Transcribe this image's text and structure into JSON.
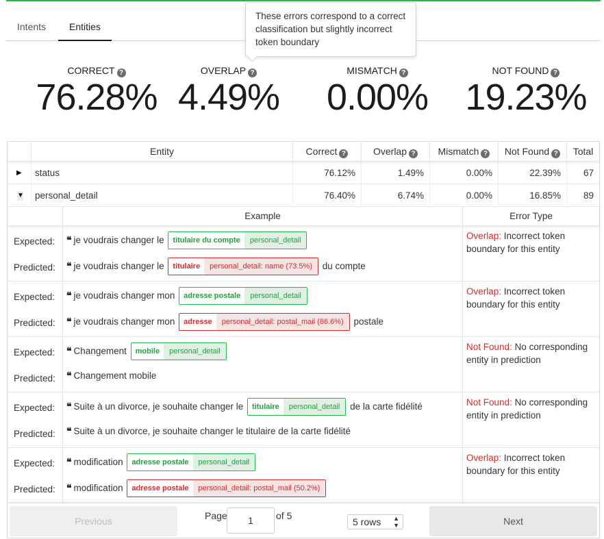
{
  "tabs": [
    {
      "label": "Intents"
    },
    {
      "label": "Entities"
    }
  ],
  "tooltip": "These errors correspond to a correct classification but slightly incorrect token boundary",
  "stats": [
    {
      "label": "CORRECT",
      "value": "76.28%"
    },
    {
      "label": "OVERLAP",
      "value": "4.49%"
    },
    {
      "label": "MISMATCH",
      "value": "0.00%"
    },
    {
      "label": "NOT FOUND",
      "value": "19.23%"
    }
  ],
  "table": {
    "headers": {
      "entity": "Entity",
      "correct": "Correct",
      "overlap": "Overlap",
      "mismatch": "Mismatch",
      "not_found": "Not Found",
      "total": "Total"
    },
    "rows": [
      {
        "entity": "status",
        "correct": "76.12%",
        "overlap": "1.49%",
        "mismatch": "0.00%",
        "not_found": "22.39%",
        "total": "67",
        "expanded": false
      },
      {
        "entity": "personal_detail",
        "correct": "76.40%",
        "overlap": "6.74%",
        "mismatch": "0.00%",
        "not_found": "16.85%",
        "total": "89",
        "expanded": true
      }
    ]
  },
  "subtable": {
    "headers": {
      "example": "Example",
      "error_type": "Error Type"
    },
    "expected_label": "Expected:",
    "predicted_label": "Predicted:",
    "examples": [
      {
        "expected": {
          "before": "je voudrais changer le",
          "tag_text": "titulaire du compte",
          "tag_entity": "personal_detail",
          "after": ""
        },
        "predicted": {
          "before": "je voudrais changer le",
          "tag_text": "titulaire",
          "tag_entity": "personal_detail: name (73.5%)",
          "after": "du compte"
        },
        "error_kind": "Overlap:",
        "error_desc": "Incorrect token boundary for this entity"
      },
      {
        "expected": {
          "before": "je voudrais changer mon",
          "tag_text": "adresse postale",
          "tag_entity": "personal_detail",
          "after": ""
        },
        "predicted": {
          "before": "je voudrais changer mon",
          "tag_text": "adresse",
          "tag_entity": "personal_detail: postal_mail (86.6%)",
          "after": "postale"
        },
        "error_kind": "Overlap:",
        "error_desc": "Incorrect token boundary for this entity"
      },
      {
        "expected": {
          "before": "Changement",
          "tag_text": "mobile",
          "tag_entity": "personal_detail",
          "after": ""
        },
        "predicted_plain": "Changement mobile",
        "error_kind": "Not Found:",
        "error_desc": "No corresponding entity in prediction"
      },
      {
        "expected": {
          "before": "Suite à un divorce, je souhaite changer le",
          "tag_text": "titulaire",
          "tag_entity": "personal_detail",
          "after": "de la carte fidélité"
        },
        "predicted_plain": "Suite à un divorce, je souhaite changer le titulaire de la carte fidélité",
        "error_kind": "Not Found:",
        "error_desc": "No corresponding entity in prediction"
      },
      {
        "expected": {
          "before": "modification",
          "tag_text": "adresse postale",
          "tag_entity": "personal_detail",
          "after": ""
        },
        "predicted": {
          "before": "modification",
          "tag_text": "adresse postale",
          "tag_entity": "personal_detail: postal_mail (50.2%)",
          "after": ""
        },
        "error_kind": "Overlap:",
        "error_desc": "Incorrect token boundary for this entity"
      }
    ]
  },
  "pagination": {
    "previous": "Previous",
    "next": "Next",
    "page_label": "Page",
    "page_value": "1",
    "of_label": "of 5",
    "rows_option": "5 rows"
  },
  "icons": {
    "question": "question-circle-icon",
    "expand": "caret-right-icon",
    "collapse": "caret-down-icon",
    "quote": "quote-left-icon"
  },
  "colors": {
    "accent_green": "#21ba45",
    "error_red": "#db2828",
    "entity_green_bg": "#e2efe5",
    "entity_red_bg": "#f5e4e4"
  }
}
